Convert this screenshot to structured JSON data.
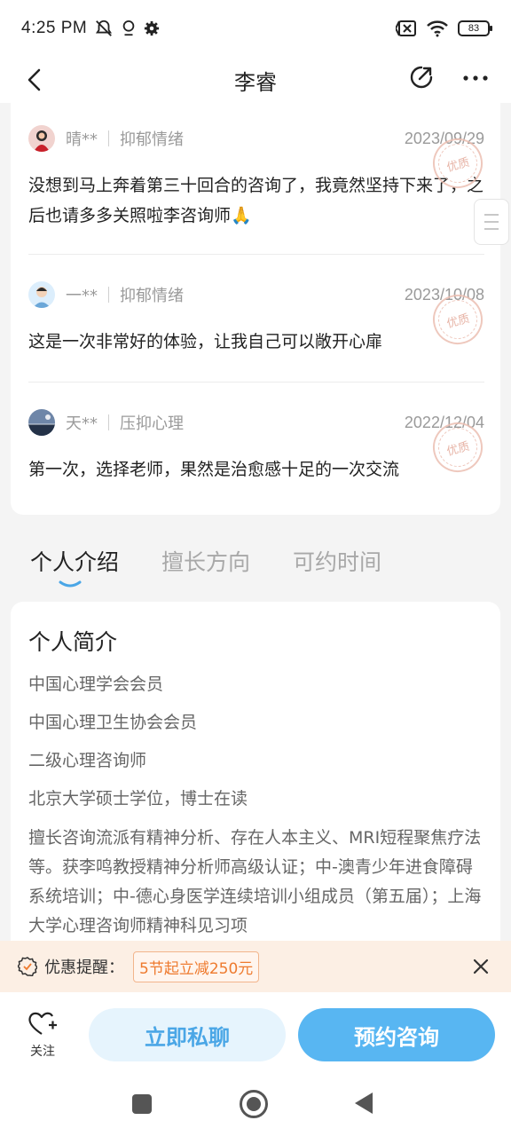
{
  "status_bar": {
    "time": "4:25 PM",
    "battery": "83",
    "icons": [
      "mute-icon",
      "location-icon",
      "settings-icon",
      "sim-off-icon",
      "wifi-icon",
      "battery-icon"
    ]
  },
  "header": {
    "title": "李睿",
    "back_icon": "chevron-left-icon",
    "share_icon": "share-icon",
    "more_icon": "more-icon"
  },
  "reviews": [
    {
      "user": "晴**",
      "tag": "抑郁情绪",
      "date": "2023/09/29",
      "text": "没想到马上奔着第三十回合的咨询了，我竟然坚持下来了，之后也请多多关照啦李咨询师🙏",
      "stamp": "优质"
    },
    {
      "user": "一**",
      "tag": "抑郁情绪",
      "date": "2023/10/08",
      "text": "这是一次非常好的体验，让我自己可以敞开心扉",
      "stamp": "优质"
    },
    {
      "user": "天**",
      "tag": "压抑心理",
      "date": "2022/12/04",
      "text": "第一次，选择老师，果然是治愈感十足的一次交流",
      "stamp": "优质"
    }
  ],
  "tabs": [
    {
      "label": "个人介绍",
      "active": true
    },
    {
      "label": "擅长方向",
      "active": false
    },
    {
      "label": "可约时间",
      "active": false
    }
  ],
  "intro": {
    "heading": "个人简介",
    "items": [
      "中国心理学会会员",
      "中国心理卫生协会会员",
      "二级心理咨询师",
      "北京大学硕士学位，博士在读",
      "擅长咨询流派有精神分析、存在人本主义、MRI短程聚焦疗法等。获李鸣教授精神分析师高级认证；中-澳青少年进食障碍系统培训；中-德心身医学连续培训小组成员（第五届）；上海大学心理咨询师精神科见习项"
    ]
  },
  "promo": {
    "label": "优惠提醒：",
    "badge": "5节起立减250元",
    "accent": "#ee7a2e"
  },
  "actions": {
    "follow_label": "关注",
    "chat_label": "立即私聊",
    "book_label": "预约咨询",
    "primary_color": "#58b6f2"
  }
}
